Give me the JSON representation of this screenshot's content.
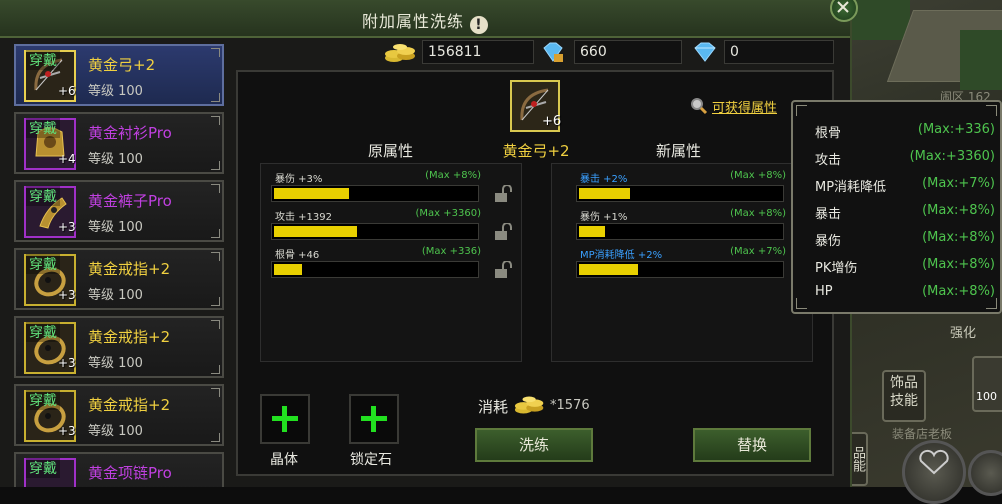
{
  "window": {
    "title": "附加属性洗练"
  },
  "currency": [
    {
      "icon": "gold-coins-icon",
      "value": "156811"
    },
    {
      "icon": "locked-diamond-icon",
      "value": "660"
    },
    {
      "icon": "diamond-icon",
      "value": "0"
    }
  ],
  "equipment_list": [
    {
      "badge": "穿戴",
      "name": "黄金弓+2",
      "level": "等级 100",
      "plus": "+6",
      "name_color": "#f0d040",
      "icon": "bow-icon",
      "selected": true
    },
    {
      "badge": "穿戴",
      "name": "黄金衬衫Pro",
      "level": "等级 100",
      "plus": "+4",
      "name_color": "#c040e0",
      "icon": "armor-icon",
      "selected": false
    },
    {
      "badge": "穿戴",
      "name": "黄金裤子Pro",
      "level": "等级 100",
      "plus": "+3",
      "name_color": "#c040e0",
      "icon": "pants-icon",
      "selected": false
    },
    {
      "badge": "穿戴",
      "name": "黄金戒指+2",
      "level": "等级 100",
      "plus": "+3",
      "name_color": "#f0d040",
      "icon": "ring-icon",
      "selected": false
    },
    {
      "badge": "穿戴",
      "name": "黄金戒指+2",
      "level": "等级 100",
      "plus": "+3",
      "name_color": "#f0d040",
      "icon": "ring-icon",
      "selected": false
    },
    {
      "badge": "穿戴",
      "name": "黄金戒指+2",
      "level": "等级 100",
      "plus": "+3",
      "name_color": "#f0d040",
      "icon": "ring-icon",
      "selected": false
    },
    {
      "badge": "穿戴",
      "name": "黄金项链Pro",
      "level": "",
      "plus": "",
      "name_color": "#c040e0",
      "icon": "necklace-icon",
      "selected": false
    }
  ],
  "selected_item": {
    "name": "黄金弓+2",
    "plus": "+6"
  },
  "obtainable_link": "可获得属性",
  "original": {
    "title": "原属性",
    "attrs": [
      {
        "label": "暴伤 +3%",
        "max": "(Max +8%)",
        "fill": 0.37
      },
      {
        "label": "攻击 +1392",
        "max": "(Max +3360)",
        "fill": 0.41
      },
      {
        "label": "根骨 +46",
        "max": "(Max +336)",
        "fill": 0.14
      }
    ]
  },
  "new": {
    "title": "新属性",
    "attrs": [
      {
        "label": "暴击 +2%",
        "max": "(Max +8%)",
        "fill": 0.25
      },
      {
        "label": "暴伤 +1%",
        "max": "(Max +8%)",
        "fill": 0.13
      },
      {
        "label": "MP消耗降低 +2%",
        "max": "(Max +7%)",
        "fill": 0.29
      }
    ]
  },
  "slots": [
    {
      "label": "晶体"
    },
    {
      "label": "锁定石"
    }
  ],
  "cost": {
    "label": "消耗",
    "value": "*1576"
  },
  "buttons": {
    "refine": "洗练",
    "replace": "替换"
  },
  "tooltip": {
    "rows": [
      {
        "name": "根骨",
        "max": "(Max:+336)"
      },
      {
        "name": "攻击",
        "max": "(Max:+3360)"
      },
      {
        "name": "MP消耗降低",
        "max": "(Max:+7%)"
      },
      {
        "name": "暴击",
        "max": "(Max:+8%)"
      },
      {
        "name": "暴伤",
        "max": "(Max:+8%)"
      },
      {
        "name": "PK增伤",
        "max": "(Max:+8%)"
      },
      {
        "name": "HP",
        "max": "(Max:+8%)"
      }
    ]
  },
  "scene": {
    "map_label": "闹区 162",
    "enhance_label": "强化",
    "accessory_skill": "饰品技能",
    "shop_label": "装备店老板",
    "side_tab": "品能",
    "slot_num": "100"
  },
  "colors": {
    "accent_green": "#4ec44e",
    "bar_fill": "#e8d000",
    "gold": "#f0d040",
    "purple": "#c040e0",
    "blue": "#3aa0ff"
  }
}
